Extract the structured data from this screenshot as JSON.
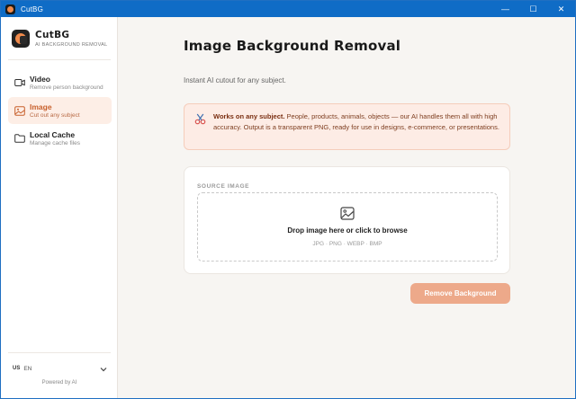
{
  "window": {
    "title": "CutBG",
    "controls": {
      "minimize": "—",
      "maximize": "☐",
      "close": "✕"
    }
  },
  "sidebar": {
    "brand": {
      "name": "CutBG",
      "subtitle": "AI BACKGROUND REMOVAL"
    },
    "items": [
      {
        "label": "Video",
        "description": "Remove person background",
        "icon": "video-camera-icon",
        "active": false
      },
      {
        "label": "Image",
        "description": "Cut out any subject",
        "icon": "image-icon",
        "active": true
      },
      {
        "label": "Local Cache",
        "description": "Manage cache files",
        "icon": "folder-icon",
        "active": false
      }
    ],
    "language": {
      "flag": "US",
      "code": "EN"
    },
    "footer": "Powered by AI"
  },
  "main": {
    "title": "Image Background Removal",
    "subtitle": "Instant AI cutout for any subject.",
    "info": {
      "icon": "scissors-icon",
      "bold": "Works on any subject.",
      "text": " People, products, animals, objects — our AI handles them all with high accuracy. Output is a transparent PNG, ready for use in designs, e-commerce, or presentations."
    },
    "upload": {
      "section_label": "SOURCE IMAGE",
      "prompt": "Drop image here or click to browse",
      "formats": "JPG · PNG · WEBP · BMP"
    },
    "action_button": "Remove Background"
  },
  "colors": {
    "accent": "#eda98a",
    "active_bg": "#fdeee6",
    "active_text": "#c8602c",
    "info_bg": "#fdece5",
    "titlebar": "#0f6cc6"
  }
}
